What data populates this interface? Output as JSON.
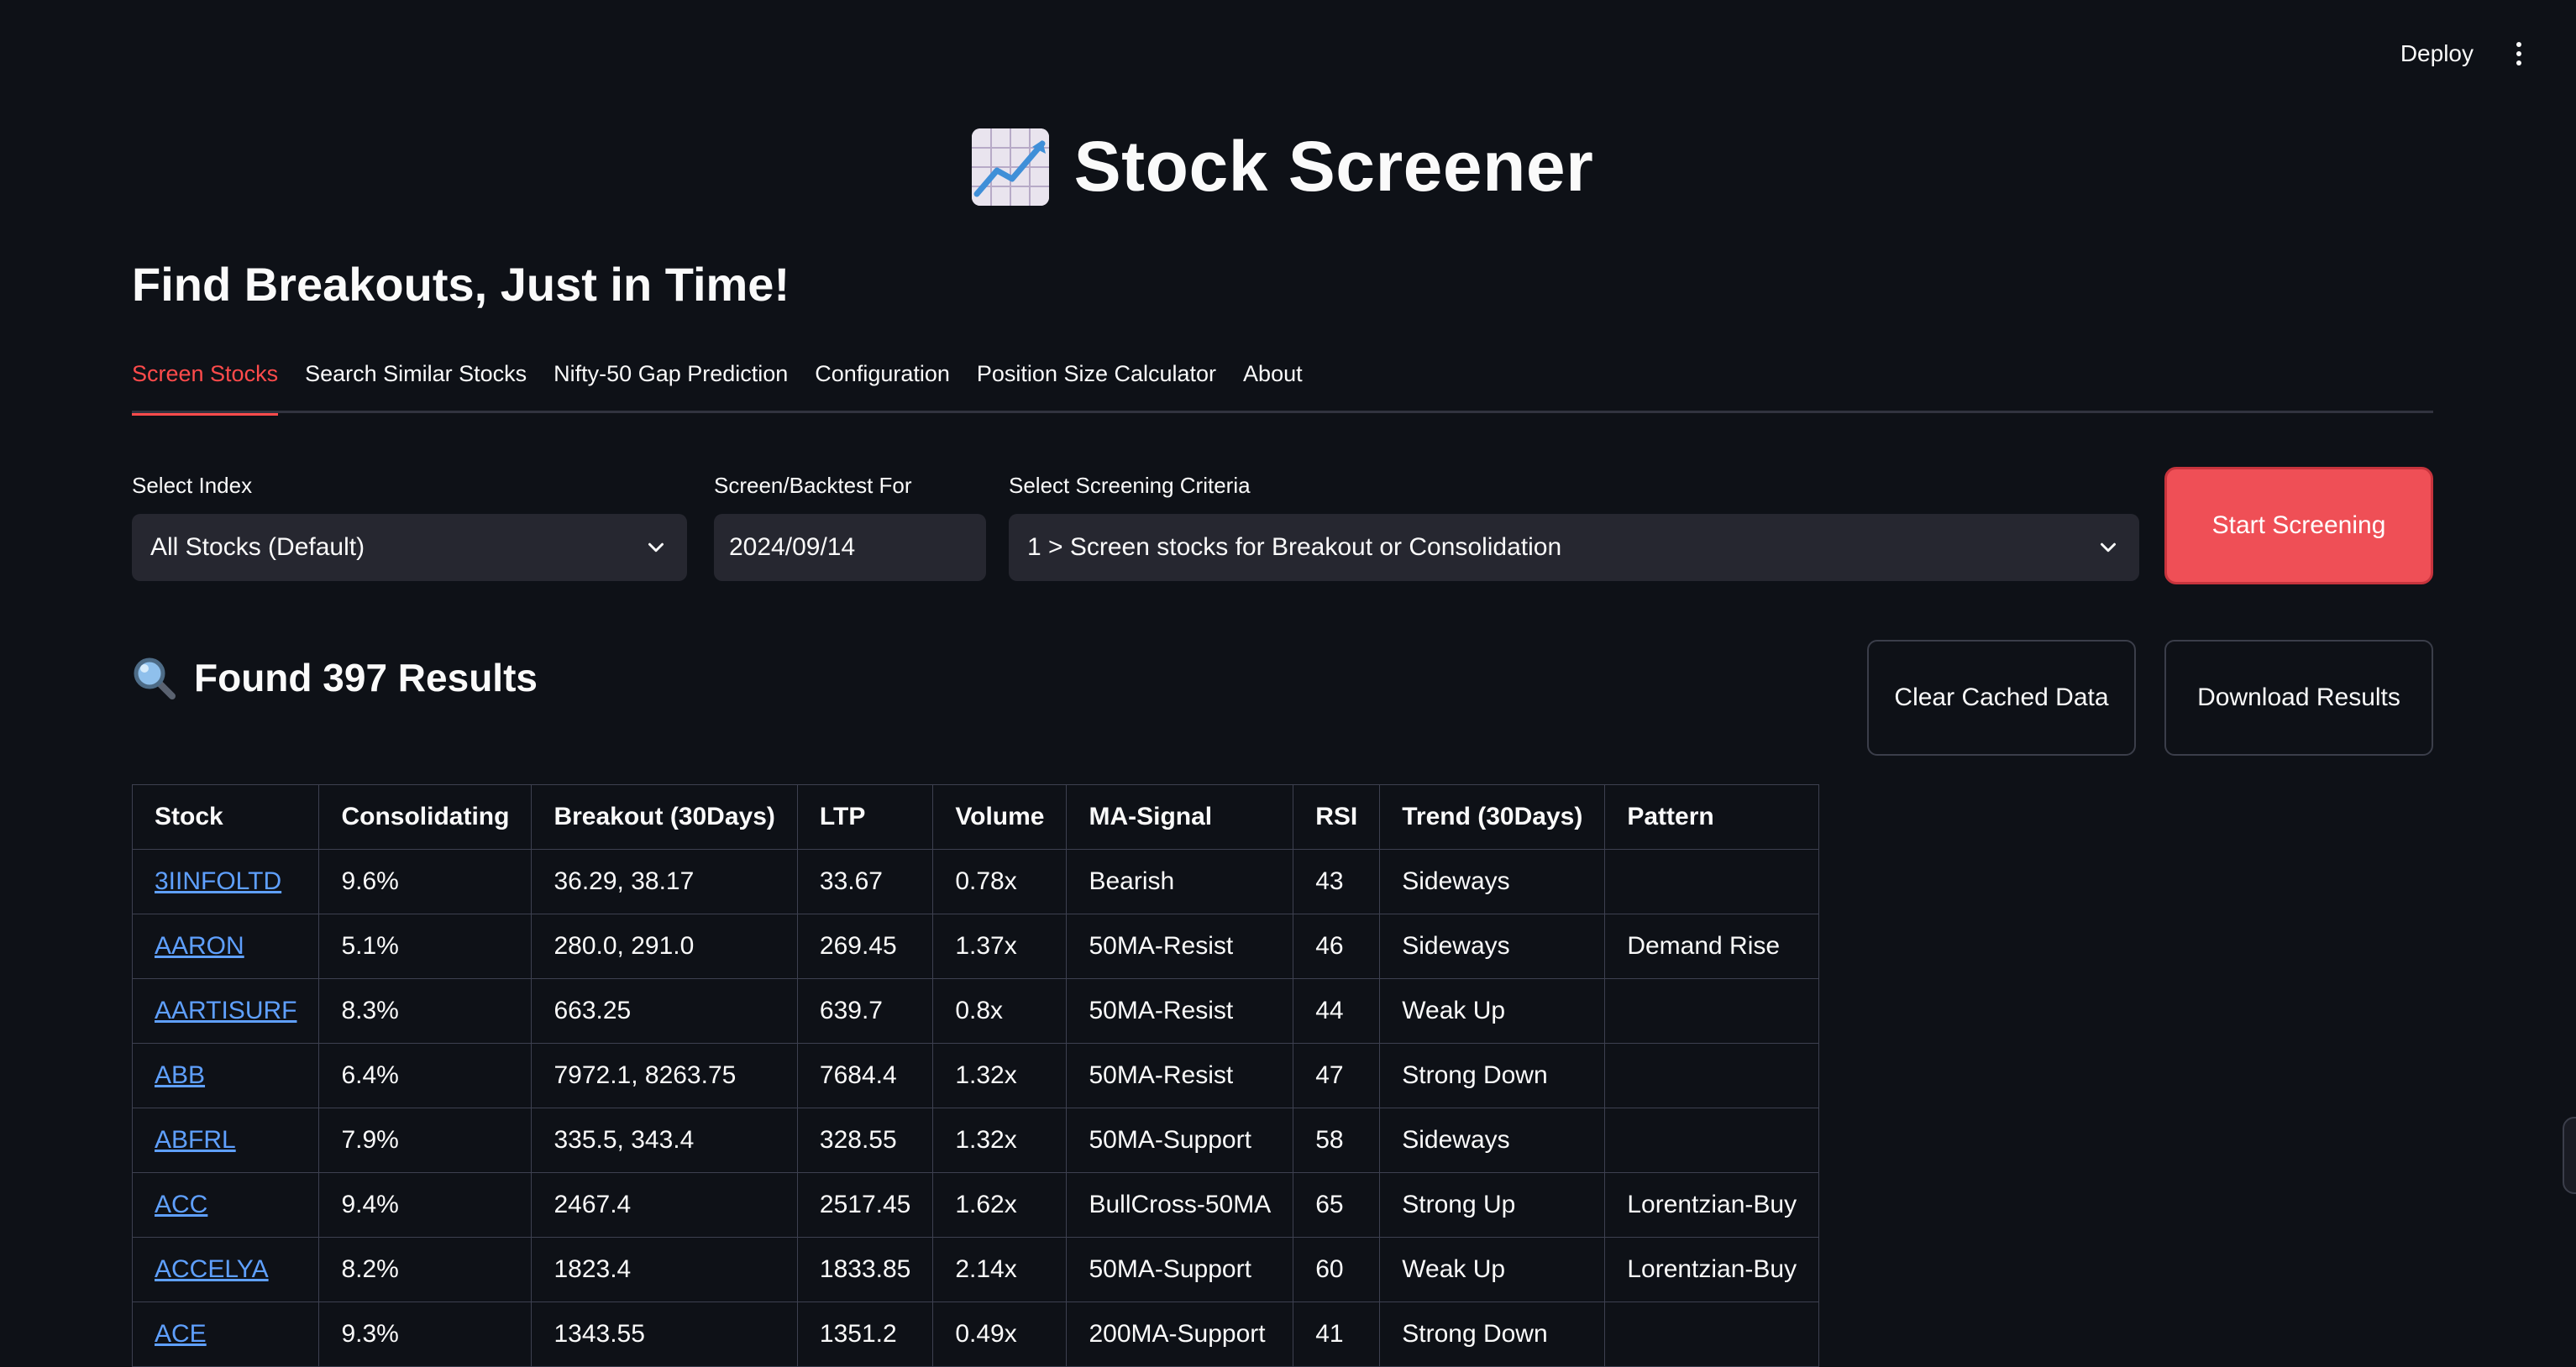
{
  "toolbar": {
    "deploy_label": "Deploy"
  },
  "header": {
    "icon": "chart-increasing-icon",
    "title": "Stock Screener",
    "subtitle": "Find Breakouts, Just in Time!"
  },
  "tabs": [
    {
      "label": "Screen Stocks",
      "active": true
    },
    {
      "label": "Search Similar Stocks",
      "active": false
    },
    {
      "label": "Nifty-50 Gap Prediction",
      "active": false
    },
    {
      "label": "Configuration",
      "active": false
    },
    {
      "label": "Position Size Calculator",
      "active": false
    },
    {
      "label": "About",
      "active": false
    }
  ],
  "form": {
    "index_label": "Select Index",
    "index_value": "All Stocks (Default)",
    "date_label": "Screen/Backtest For",
    "date_value": "2024/09/14",
    "criteria_label": "Select Screening Criteria",
    "criteria_value": "1 > Screen stocks for Breakout or Consolidation",
    "start_button": "Start Screening"
  },
  "actions": {
    "clear_cache": "Clear Cached Data",
    "download": "Download Results"
  },
  "results": {
    "icon": "magnifying-glass-icon",
    "heading": "Found 397 Results",
    "columns": [
      "Stock",
      "Consolidating",
      "Breakout (30Days)",
      "LTP",
      "Volume",
      "MA-Signal",
      "RSI",
      "Trend (30Days)",
      "Pattern"
    ],
    "rows": [
      [
        "3IINFOLTD",
        "9.6%",
        "36.29, 38.17",
        "33.67",
        "0.78x",
        "Bearish",
        "43",
        "Sideways",
        ""
      ],
      [
        "AARON",
        "5.1%",
        "280.0, 291.0",
        "269.45",
        "1.37x",
        "50MA-Resist",
        "46",
        "Sideways",
        "Demand Rise"
      ],
      [
        "AARTISURF",
        "8.3%",
        "663.25",
        "639.7",
        "0.8x",
        "50MA-Resist",
        "44",
        "Weak Up",
        ""
      ],
      [
        "ABB",
        "6.4%",
        "7972.1, 8263.75",
        "7684.4",
        "1.32x",
        "50MA-Resist",
        "47",
        "Strong Down",
        ""
      ],
      [
        "ABFRL",
        "7.9%",
        "335.5, 343.4",
        "328.55",
        "1.32x",
        "50MA-Support",
        "58",
        "Sideways",
        ""
      ],
      [
        "ACC",
        "9.4%",
        "2467.4",
        "2517.45",
        "1.62x",
        "BullCross-50MA",
        "65",
        "Strong Up",
        "Lorentzian-Buy"
      ],
      [
        "ACCELYA",
        "8.2%",
        "1823.4",
        "1833.85",
        "2.14x",
        "50MA-Support",
        "60",
        "Weak Up",
        "Lorentzian-Buy"
      ],
      [
        "ACE",
        "9.3%",
        "1343.55",
        "1351.2",
        "0.49x",
        "200MA-Support",
        "41",
        "Strong Down",
        ""
      ]
    ]
  },
  "colors": {
    "background": "#0e1117",
    "accent": "#ff4b4b",
    "primary_button": "#ef4f56",
    "link": "#5fa0ff",
    "input_bg": "#262730"
  }
}
